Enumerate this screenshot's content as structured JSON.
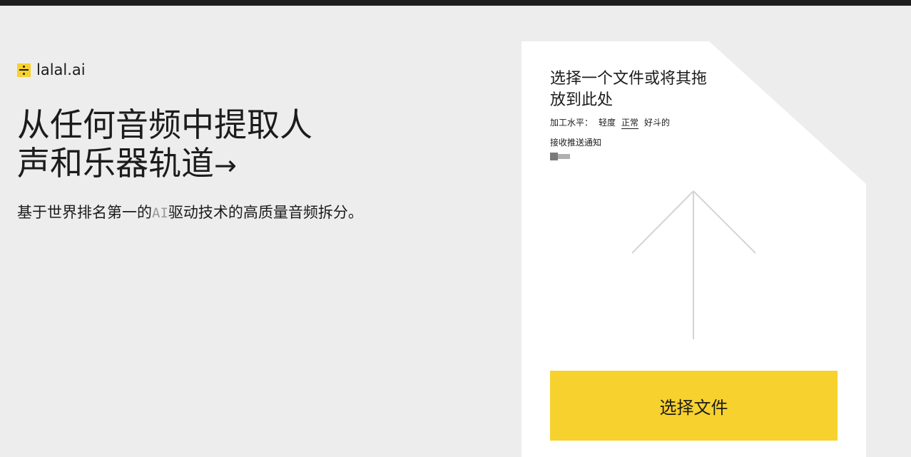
{
  "brand": {
    "name": "lalal.ai",
    "accent": "#f7d12e"
  },
  "hero": {
    "title_line1": "从任何音频中提取人",
    "title_line2": "声和乐器轨道",
    "title_arrow": "→",
    "subtitle_pre": "基于世界排名第一的",
    "subtitle_ai": "AI",
    "subtitle_post": "驱动技术的高质量音频拆分。"
  },
  "upload": {
    "title": "选择一个文件或将其拖放到此处",
    "level_label": "加工水平：",
    "levels": [
      "轻度",
      "正常",
      "好斗的"
    ],
    "active_level": "正常",
    "notify_label": "接收推送通知",
    "notify_enabled": false,
    "arrow_icon": "upload-arrow-icon",
    "button_label": "选择文件"
  },
  "colors": {
    "background": "#ededed",
    "card": "#ffffff",
    "topbar": "#1e1e1e",
    "button": "#f7d12e"
  }
}
